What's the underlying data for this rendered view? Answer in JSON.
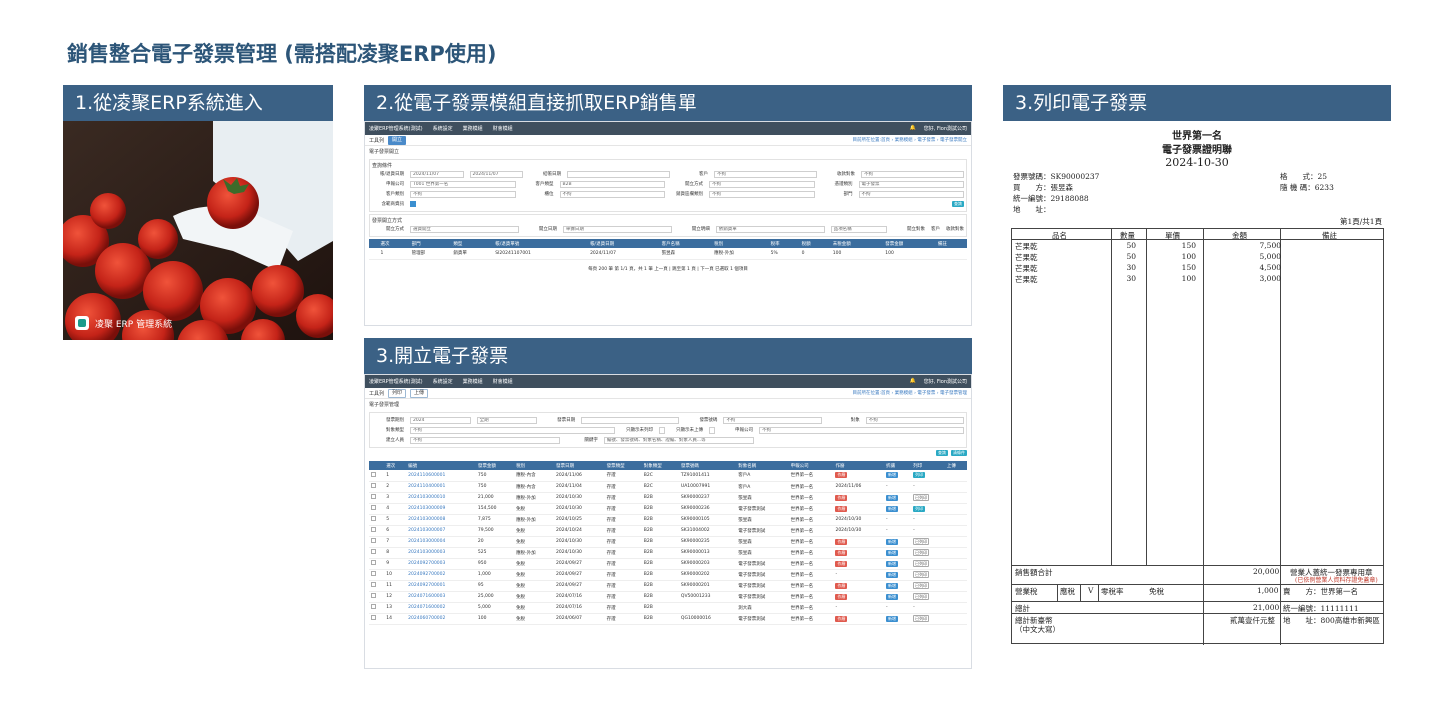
{
  "title": "銷售整合電子發票管理 (需搭配凌聚ERP使用)",
  "steps": {
    "s1": "1.從凌聚ERP系統進入",
    "s2": "2.從電子發票模組直接抓取ERP銷售單",
    "s3": "3.開立電子發票",
    "s4": "3.列印電子發票"
  },
  "photo": {
    "caption": "凌聚 ERP 管理系統"
  },
  "erp1": {
    "nav": {
      "brand": "凌聚ERP管理系統(測試)",
      "m1": "系統設定",
      "m2": "業務模組",
      "m3": "財會模組",
      "user": "您好, Fion測試公司"
    },
    "toolbar": {
      "label": "工具列",
      "btn": "開立",
      "breadcrumb": "目前所在位置:首頁 › 業務模組 › 電子發票 › 電子發票開立"
    },
    "page_title": "電子發票開立",
    "sec1": "查詢條件",
    "f": {
      "l1": "帳/退貨日期",
      "v1a": "2024/11/07",
      "v1b": "2024/11/07",
      "l2": "結帳日期",
      "l3": "客戶",
      "v3": "不拘",
      "l4": "收款對象",
      "v4": "不拘",
      "l5": "申報公司",
      "v5": "T001 世界第一名",
      "l6": "客戶類型",
      "v6": "B2B",
      "l7": "開立方式",
      "v7": "不拘",
      "l8": "憑證類別",
      "v8": "電子發票",
      "l9": "客戶類別",
      "v9": "不拘",
      "l10": "櫃位",
      "v10": "不拘",
      "l11": "銷貨區欄類別",
      "v11": "不拘",
      "l12": "部門",
      "v12": "不拘",
      "l13": "含範商資訊"
    },
    "query_btn": "查詢",
    "sec2": "發票開立方式",
    "g": {
      "l1": "開立方式",
      "v1": "選貨開立",
      "l2": "開立日期",
      "v2": "單據日期",
      "l3": "開立明細",
      "v3": "依銷貨單",
      "v3b": "品項名稱",
      "l4": "開立對象",
      "o1": "客戶",
      "o2": "收款對象"
    },
    "cols": [
      "",
      "選次",
      "部門",
      "類型",
      "帳/退貨單號",
      "帳/退貨日期",
      "客戶名稱",
      "稅別",
      "稅率",
      "稅額",
      "未稅金額",
      "發票金額",
      "備註"
    ],
    "row": [
      "",
      "1",
      "管理部",
      "銷貨單",
      "SI20241107001",
      "2024/11/07",
      "張昱森",
      "應稅-外加",
      "5%",
      "0",
      "100",
      "100",
      ""
    ],
    "pager": "每頁 200 筆  第 1/1 頁，共 1 筆  上一頁 | 跳至第 1 頁 | 下一頁  已選取 1 個項目"
  },
  "erp2": {
    "nav": {
      "brand": "凌聚ERP管理系統(測試)",
      "m1": "系統設定",
      "m2": "業務模組",
      "m3": "財會模組",
      "user": "您好, Fion測試公司"
    },
    "toolbar": {
      "label": "工具列",
      "b1": "列印",
      "b2": "上傳",
      "breadcrumb": "目前所在位置:首頁 › 業務模組 › 電子發票 › 電子發票管理"
    },
    "page_title": "電子發票管理",
    "f": {
      "l1": "發票期別",
      "v1a": "2024",
      "v1b": "全期",
      "l2": "發票日期",
      "l3": "發票號碼",
      "v3": "不拘",
      "l4": "對象",
      "v4": "不拘",
      "l5": "對象類型",
      "v5": "不拘",
      "l6": "只顯示未列印",
      "l7": "只顯示未上傳",
      "l8": "申報公司",
      "v8": "不拘",
      "l9": "建立人員",
      "v9": "不拘",
      "l10": "關鍵字",
      "v10": "編號、發票號碼、對象名稱、證編、對象人員...等"
    },
    "b_query": "查詢",
    "b_clear": "清條件",
    "cols": [
      "",
      "選次",
      "編號",
      "發票金額",
      "稅別",
      "發票日期",
      "發票類型",
      "對象類型",
      "發票號碼",
      "對象名稱",
      "申報公司",
      "作廢",
      "折讓",
      "列印",
      "上傳"
    ],
    "rows": [
      [
        "1",
        "2024110600001",
        "750",
        "應稅-內含",
        "2024/11/06",
        "存證",
        "B2C",
        "TZ91001411",
        "客戶A",
        "世界第一名",
        "作廢",
        "新增",
        "列印",
        ""
      ],
      [
        "2",
        "2024110400001",
        "750",
        "應稅-內含",
        "2024/11/04",
        "存證",
        "B2C",
        "UA10007991",
        "客戶A",
        "世界第一名",
        "2024/11/06",
        "-",
        "-",
        ""
      ],
      [
        "3",
        "2024103000010",
        "21,000",
        "應稅-外加",
        "2024/10/30",
        "存證",
        "B2B",
        "SK90000237",
        "張昱森",
        "世界第一名",
        "作廢",
        "新增",
        "已列印",
        ""
      ],
      [
        "4",
        "2024103000009",
        "154,500",
        "免稅",
        "2024/10/30",
        "存證",
        "B2B",
        "SK90000236",
        "電子發票測試",
        "世界第一名",
        "作廢",
        "新增",
        "列印",
        ""
      ],
      [
        "5",
        "2024103000008",
        "7,875",
        "應稅-外加",
        "2024/10/25",
        "存證",
        "B2B",
        "SK90000105",
        "張昱森",
        "世界第一名",
        "2024/10/30",
        "-",
        "-",
        ""
      ],
      [
        "6",
        "2024103000007",
        "79,500",
        "免稅",
        "2024/10/24",
        "存證",
        "B2B",
        "SK31004002",
        "電子發票測試",
        "世界第一名",
        "2024/10/30",
        "-",
        "-",
        ""
      ],
      [
        "7",
        "2024103000004",
        "20",
        "免稅",
        "2024/10/30",
        "存證",
        "B2B",
        "SK90000235",
        "張昱森",
        "世界第一名",
        "作廢",
        "新增",
        "已列印",
        ""
      ],
      [
        "8",
        "2024103000003",
        "525",
        "應稅-外加",
        "2024/10/30",
        "存證",
        "B2B",
        "SK90000013",
        "張昱森",
        "世界第一名",
        "作廢",
        "新增",
        "已列印",
        ""
      ],
      [
        "9",
        "2024092700003",
        "950",
        "免稅",
        "2024/09/27",
        "存證",
        "B2B",
        "SK90000203",
        "電子發票測試",
        "世界第一名",
        "作廢",
        "新增",
        "已列印",
        ""
      ],
      [
        "10",
        "2024092700002",
        "1,000",
        "免稅",
        "2024/09/27",
        "存證",
        "B2B",
        "SK90000202",
        "電子發票測試",
        "世界第一名",
        "-",
        "新增",
        "已列印",
        ""
      ],
      [
        "11",
        "2024092700001",
        "95",
        "免稅",
        "2024/09/27",
        "存證",
        "B2B",
        "SK90000201",
        "電子發票測試",
        "世界第一名",
        "作廢",
        "新增",
        "已列印",
        ""
      ],
      [
        "12",
        "2024071600003",
        "25,000",
        "免稅",
        "2024/07/16",
        "存證",
        "B2B",
        "QV50001233",
        "電子發票測試",
        "世界第一名",
        "作廢",
        "新增",
        "已列印",
        ""
      ],
      [
        "13",
        "2024071600002",
        "5,000",
        "免稅",
        "2024/07/16",
        "存證",
        "B2B",
        "",
        "測大森",
        "世界第一名",
        "-",
        "-",
        "-",
        ""
      ],
      [
        "14",
        "2024060700002",
        "100",
        "免稅",
        "2024/06/07",
        "存證",
        "B2B",
        "QG10000016",
        "電子發票測試",
        "世界第一名",
        "作廢",
        "新增",
        "已列印",
        ""
      ]
    ]
  },
  "invoice": {
    "company": "世界第一名",
    "doc_title": "電子發票證明聯",
    "date": "2024-10-30",
    "no_label": "發票號碼：SK90000237",
    "buyer_label": "買　　方：張昱森",
    "tax_id_label": "統一編號：29188088",
    "addr_label": "地　　址：",
    "format_label": "格　　式：25",
    "rand_label": "隨 機 碼：6233",
    "page_label": "第1頁/共1頁",
    "cols": [
      "品名",
      "數量",
      "單價",
      "金額",
      "備註"
    ],
    "items": [
      [
        "芒果乾",
        "50",
        "150",
        "7,500"
      ],
      [
        "芒果乾",
        "50",
        "100",
        "5,000"
      ],
      [
        "芒果乾",
        "30",
        "150",
        "4,500"
      ],
      [
        "芒果乾",
        "30",
        "100",
        "3,000"
      ]
    ],
    "subtotal_label": "銷售額合計",
    "subtotal": "20,000",
    "stamp1": "營業人蓋統一發票專用章",
    "stamp2": "(已依例營業人資料存證免蓋章)",
    "tax_label": "營業稅",
    "taxable": "應稅",
    "mark": "V",
    "zero": "零稅率",
    "exempt": "免稅",
    "tax": "1,000",
    "seller_label": "賣　　方：世界第一名",
    "total_label": "總計",
    "total": "21,000",
    "seller_id": "統一編號：11111111",
    "words_label1": "總計新臺幣",
    "words_label2": "（中文大寫）",
    "words": "貳萬壹仟元整",
    "seller_addr": "地　　址：800高雄市新興區"
  },
  "colors": {
    "header_blue": "#3b6185",
    "title_blue": "#2c5578",
    "nav_dark": "#3f4f5e",
    "table_head": "#3b6d9e"
  }
}
